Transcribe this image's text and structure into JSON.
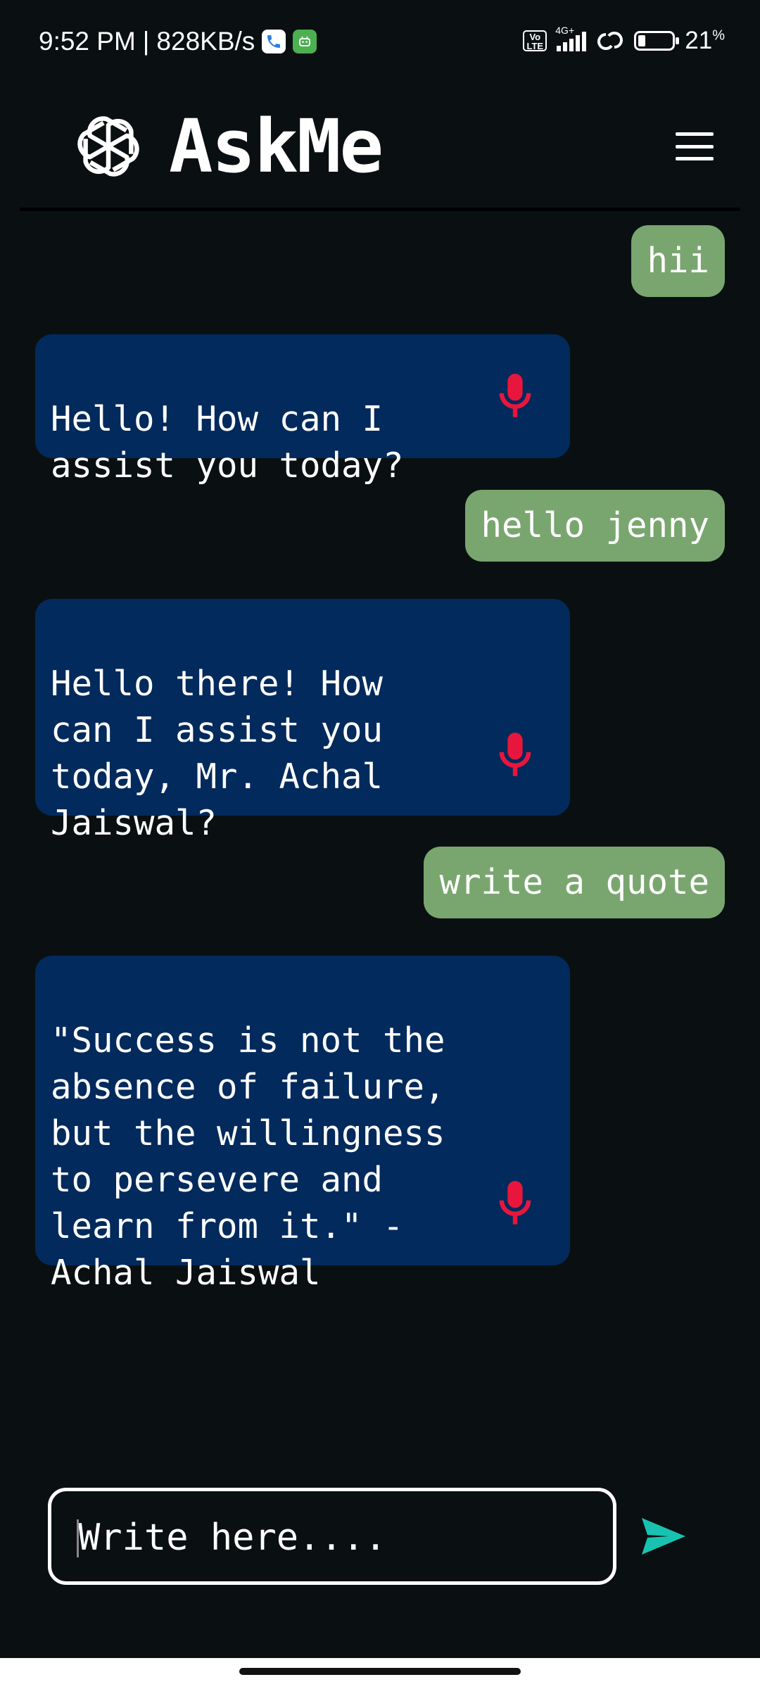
{
  "status_bar": {
    "time": "9:52 PM",
    "net_speed": "828KB/s",
    "volte": "Vo LTE",
    "network": "4G+",
    "battery_level": 0.21,
    "battery_pct": "21",
    "battery_unit": "%"
  },
  "header": {
    "title": "AskMe",
    "logo_icon": "openai-knot-icon",
    "menu_icon": "hamburger-menu-icon"
  },
  "messages": [
    {
      "role": "user",
      "text": "hii"
    },
    {
      "role": "bot",
      "text": "Hello! How can I\nassist you today?"
    },
    {
      "role": "user",
      "text": "hello jenny"
    },
    {
      "role": "bot",
      "text": "Hello there! How\ncan I assist you\ntoday, Mr. Achal\nJaiswal?"
    },
    {
      "role": "user",
      "text": "write a quote"
    },
    {
      "role": "bot",
      "text": "\"Success is not the\nabsence of failure,\nbut the willingness\nto persevere and\nlearn from it.\" -\nAchal Jaiswal"
    }
  ],
  "composer": {
    "placeholder": "Write here....",
    "send_icon": "send-icon"
  },
  "colors": {
    "background": "#0a1012",
    "user_bubble": "#79a66f",
    "bot_bubble": "#022a5c",
    "mic": "#e8163c",
    "send": "#19c2b0"
  }
}
